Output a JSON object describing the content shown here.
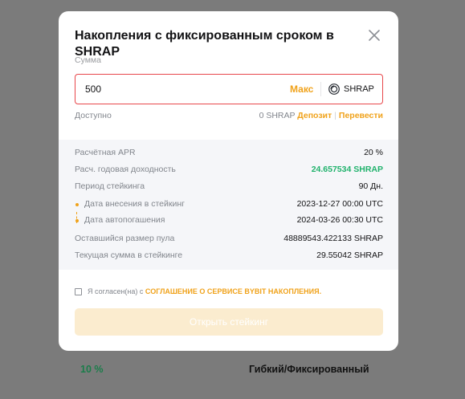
{
  "background": {
    "apr": "10 %",
    "type": "Гибкий/Фиксированный"
  },
  "modal": {
    "title": "Накопления с фиксированным сроком в SHRAP",
    "close_icon": "close-icon",
    "sum_label": "Сумма",
    "amount_value": "500",
    "max_label": "Макс",
    "coin": "SHRAP",
    "coin_icon": "shrap-coin-icon",
    "available_label": "Доступно",
    "available_value": "0 SHRAP",
    "deposit_link": "Депозит",
    "transfer_link": "Перевести",
    "info": {
      "apr_label": "Расчётная APR",
      "apr_value": "20 %",
      "yield_label": "Расч. годовая доходность",
      "yield_value": "24.657534 SHRAP",
      "period_label": "Период стейкинга",
      "period_value": "90 Дн.",
      "start_label": "Дата внесения в стейкинг",
      "start_value": "2023-12-27 00:00 UTC",
      "end_label": "Дата автопогашения",
      "end_value": "2024-03-26 00:30 UTC",
      "pool_label": "Оставшийся размер пула",
      "pool_value": "48889543.422133 SHRAP",
      "staked_label": "Текущая сумма в стейкинге",
      "staked_value": "29.55042 SHRAP"
    },
    "agree_prefix": "Я согласен(на) с",
    "agree_link": "СОГЛАШЕНИЕ О СЕРВИСЕ BYBIT НАКОПЛЕНИЯ.",
    "stake_button": "Открыть стейкинг"
  },
  "colors": {
    "accent": "#f0a21a",
    "error_border": "#e8474b",
    "positive": "#20b26c",
    "overlay": "#7b7b7b"
  }
}
